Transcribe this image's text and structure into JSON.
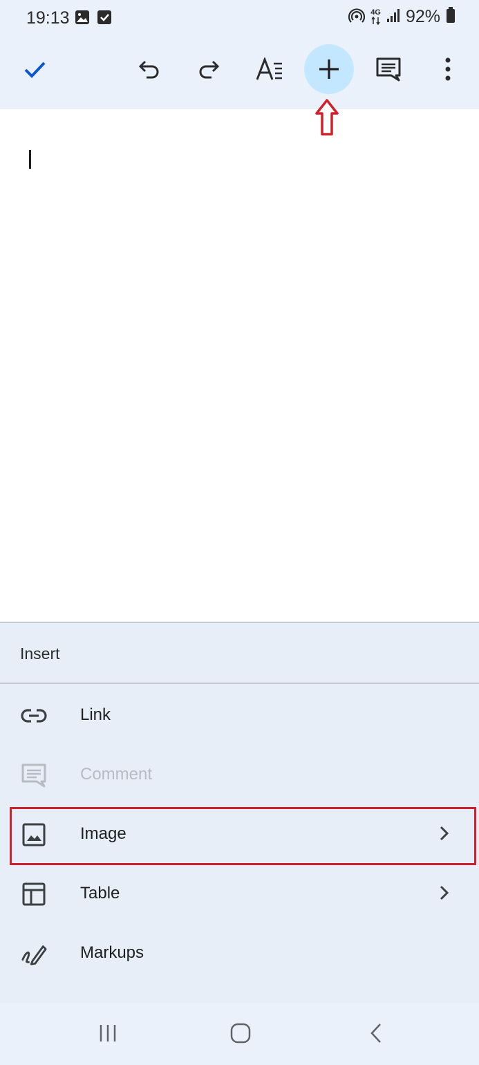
{
  "status_bar": {
    "time": "19:13",
    "network_label": "4G",
    "battery_percent": "92%",
    "icons": [
      "image-notification-icon",
      "check-notification-icon",
      "hotspot-icon",
      "network-4g-icon",
      "signal-icon",
      "battery-icon"
    ]
  },
  "toolbar": {
    "icons": [
      "check-icon",
      "undo-icon",
      "redo-icon",
      "text-format-icon",
      "plus-icon",
      "comment-icon",
      "more-vert-icon"
    ],
    "accent_color": "#0b57d0",
    "plus_bg_color": "#c2e7ff"
  },
  "annotations": {
    "color": "#d0202a",
    "arrow_target": "insert-button",
    "highlight_target": "menu-item-image"
  },
  "insert_sheet": {
    "title": "Insert",
    "items": [
      {
        "label": "Link",
        "icon": "link-icon",
        "enabled": true,
        "has_submenu": false
      },
      {
        "label": "Comment",
        "icon": "comment-icon",
        "enabled": false,
        "has_submenu": false
      },
      {
        "label": "Image",
        "icon": "image-icon",
        "enabled": true,
        "has_submenu": true
      },
      {
        "label": "Table",
        "icon": "table-icon",
        "enabled": true,
        "has_submenu": true
      },
      {
        "label": "Markups",
        "icon": "markup-pen-icon",
        "enabled": true,
        "has_submenu": false
      }
    ]
  },
  "nav_bar": {
    "icons": [
      "recents-icon",
      "home-icon",
      "back-icon"
    ]
  }
}
